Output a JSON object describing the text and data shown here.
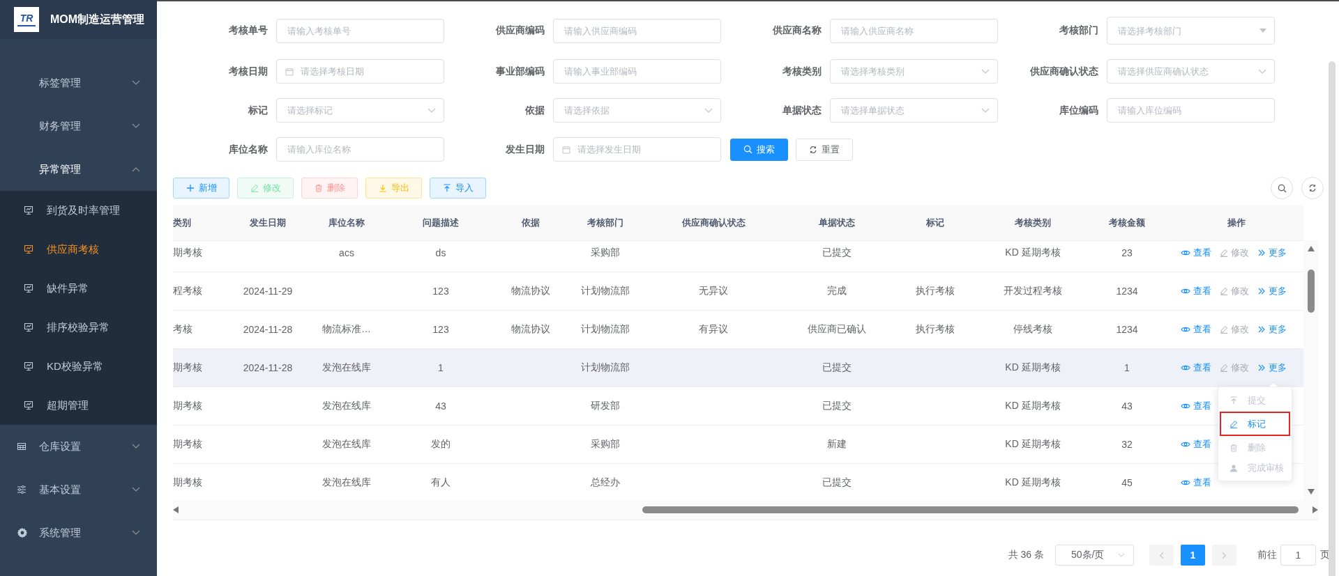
{
  "sidebar": {
    "logo_text": "TR",
    "app_title": "MOM制造运营管理",
    "items": [
      {
        "label": "标签管理",
        "kind": "plain",
        "expanded": false
      },
      {
        "label": "财务管理",
        "kind": "plain",
        "expanded": false
      },
      {
        "label": "异常管理",
        "kind": "plain",
        "expanded": true,
        "children": [
          {
            "label": "到货及时率管理",
            "selected": false
          },
          {
            "label": "供应商考核",
            "selected": true
          },
          {
            "label": "缺件异常",
            "selected": false
          },
          {
            "label": "排序校验异常",
            "selected": false
          },
          {
            "label": "KD校验异常",
            "selected": false
          },
          {
            "label": "超期管理",
            "selected": false
          }
        ]
      },
      {
        "label": "仓库设置",
        "kind": "table",
        "expanded": false
      },
      {
        "label": "基本设置",
        "kind": "sliders",
        "expanded": false
      },
      {
        "label": "系统管理",
        "kind": "gear",
        "expanded": false
      }
    ]
  },
  "search_form": {
    "fields": [
      {
        "label": "考核单号",
        "placeholder": "请输入考核单号",
        "kind": "text"
      },
      {
        "label": "供应商编码",
        "placeholder": "请输入供应商编码",
        "kind": "text"
      },
      {
        "label": "供应商名称",
        "placeholder": "请输入供应商名称",
        "kind": "text"
      },
      {
        "label": "考核部门",
        "placeholder": "请选择考核部门",
        "kind": "combo"
      },
      {
        "label": "考核日期",
        "placeholder": "请选择考核日期",
        "kind": "date"
      },
      {
        "label": "事业部编码",
        "placeholder": "请输入事业部编码",
        "kind": "text"
      },
      {
        "label": "考核类别",
        "placeholder": "请选择考核类别",
        "kind": "select"
      },
      {
        "label": "供应商确认状态",
        "placeholder": "请选择供应商确认状态",
        "kind": "select"
      },
      {
        "label": "标记",
        "placeholder": "请选择标记",
        "kind": "select"
      },
      {
        "label": "依据",
        "placeholder": "请选择依据",
        "kind": "select"
      },
      {
        "label": "单据状态",
        "placeholder": "请选择单据状态",
        "kind": "select"
      },
      {
        "label": "库位编码",
        "placeholder": "请输入库位编码",
        "kind": "text"
      },
      {
        "label": "库位名称",
        "placeholder": "请输入库位名称",
        "kind": "text"
      },
      {
        "label": "发生日期",
        "placeholder": "请选择发生日期",
        "kind": "date"
      }
    ],
    "buttons": [
      {
        "label": "搜索",
        "kind": "search"
      },
      {
        "label": "重置",
        "kind": "reset"
      }
    ]
  },
  "toolbar": {
    "buttons": [
      {
        "label": "新增",
        "kind": "add",
        "disabled": false
      },
      {
        "label": "修改",
        "kind": "edit",
        "disabled": true
      },
      {
        "label": "删除",
        "kind": "delete",
        "disabled": true
      },
      {
        "label": "导出",
        "kind": "export",
        "disabled": false
      },
      {
        "label": "导入",
        "kind": "import",
        "disabled": false
      }
    ]
  },
  "table": {
    "columns": [
      "类别",
      "发生日期",
      "库位名称",
      "问题描述",
      "依据",
      "考核部门",
      "供应商确认状态",
      "单据状态",
      "标记",
      "考核类别",
      "考核金额",
      "操作"
    ],
    "rows": [
      {
        "hovered": false,
        "cells": [
          "期考核",
          null,
          "acs",
          "ds",
          null,
          "采购部",
          null,
          "已提交",
          null,
          "KD 延期考核",
          "23"
        ],
        "actions": [
          {
            "label": "查看",
            "kind": "view",
            "disabled": false
          },
          {
            "label": "修改",
            "kind": "edit",
            "disabled": true
          },
          {
            "label": "更多",
            "kind": "more",
            "disabled": false
          }
        ]
      },
      {
        "hovered": false,
        "cells": [
          "程考核",
          "2024-11-29",
          null,
          "123",
          "物流协议",
          "计划物流部",
          "无异议",
          "完成",
          "执行考核",
          "开发过程考核",
          "1234"
        ],
        "actions": [
          {
            "label": "查看",
            "kind": "view",
            "disabled": false
          },
          {
            "label": "修改",
            "kind": "edit",
            "disabled": true
          },
          {
            "label": "更多",
            "kind": "more",
            "disabled": false
          }
        ]
      },
      {
        "hovered": false,
        "cells": [
          "考核",
          "2024-11-28",
          "物流标准…",
          "123",
          "物流协议",
          "计划物流部",
          "有异议",
          "供应商已确认",
          "执行考核",
          "停线考核",
          "1234"
        ],
        "actions": [
          {
            "label": "查看",
            "kind": "view",
            "disabled": false
          },
          {
            "label": "修改",
            "kind": "edit",
            "disabled": true
          },
          {
            "label": "更多",
            "kind": "more",
            "disabled": false
          }
        ]
      },
      {
        "hovered": true,
        "cells": [
          "期考核",
          "2024-11-28",
          "发泡在线库",
          "1",
          null,
          "计划物流部",
          null,
          "已提交",
          null,
          "KD 延期考核",
          "1"
        ],
        "actions": [
          {
            "label": "查看",
            "kind": "view",
            "disabled": false
          },
          {
            "label": "修改",
            "kind": "edit",
            "disabled": true
          },
          {
            "label": "更多",
            "kind": "more",
            "disabled": false
          }
        ]
      },
      {
        "hovered": false,
        "cells": [
          "期考核",
          null,
          "发泡在线库",
          "43",
          null,
          "研发部",
          null,
          "已提交",
          null,
          "KD 延期考核",
          "43"
        ],
        "actions": [
          {
            "label": "查看",
            "kind": "view",
            "disabled": false
          }
        ]
      },
      {
        "hovered": false,
        "cells": [
          "期考核",
          null,
          "发泡在线库",
          "发的",
          null,
          "采购部",
          null,
          "新建",
          null,
          "KD 延期考核",
          "32"
        ],
        "actions": [
          {
            "label": "查看",
            "kind": "view",
            "disabled": false
          }
        ]
      },
      {
        "hovered": false,
        "cells": [
          "期考核",
          null,
          "发泡在线库",
          "有人",
          null,
          "总经办",
          null,
          "已提交",
          null,
          "KD 延期考核",
          "45"
        ],
        "actions": [
          {
            "label": "查看",
            "kind": "view",
            "disabled": false
          }
        ]
      }
    ]
  },
  "more_menu": {
    "items": [
      {
        "label": "提交",
        "kind": "submit",
        "disabled": true,
        "highlighted": false
      },
      {
        "label": "标记",
        "kind": "mark",
        "disabled": false,
        "highlighted": true
      },
      {
        "label": "删除",
        "kind": "delete",
        "disabled": true,
        "highlighted": false
      },
      {
        "label": "完成审核",
        "kind": "approve",
        "disabled": true,
        "highlighted": false
      }
    ]
  },
  "pagination": {
    "total": "共 36 条",
    "page_size": "50条/页",
    "pages": [
      {
        "label": "1",
        "selected": true
      }
    ],
    "goto_label": "前往",
    "goto_value": "1",
    "goto_suffix": "页"
  }
}
